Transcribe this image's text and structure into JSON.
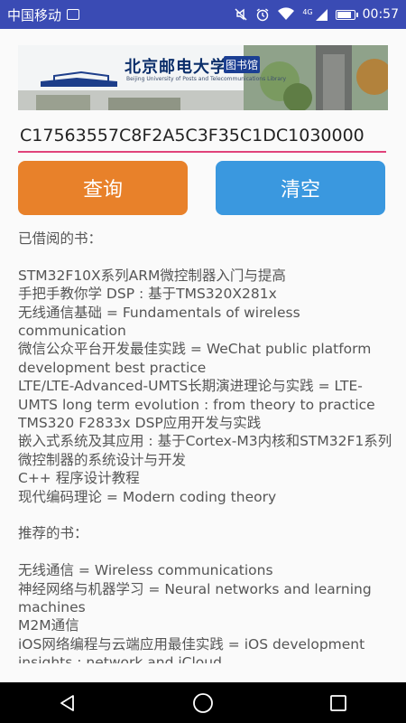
{
  "status_bar": {
    "carrier": "中国移动",
    "network": "4G",
    "time": "00:57",
    "icons": [
      "sim-icon",
      "mute-icon",
      "alarm-icon",
      "wifi-icon",
      "signal-icon",
      "battery-icon"
    ]
  },
  "banner": {
    "title": "北京邮电大学",
    "badge": "图书馆",
    "subtitle": "Beijing University of Posts and Telecommunications Library"
  },
  "search": {
    "value": "C17563557C8F2A5C3F35C1DC1030000"
  },
  "buttons": {
    "query_label": "查询",
    "clear_label": "清空"
  },
  "borrowed": {
    "heading": "已借阅的书：",
    "items": [
      "STM32F10X系列ARM微控制器入门与提高",
      "手把手教你学 DSP : 基于TMS320X281x",
      "无线通信基础 = Fundamentals of wireless communication",
      "微信公众平台开发最佳实践 = WeChat public platform development best practice",
      "LTE/LTE-Advanced-UMTS长期演进理论与实践 = LTE-UMTS long term evolution : from theory to practice",
      "TMS320 F2833x DSP应用开发与实践",
      "嵌入式系统及其应用 : 基于Cortex-M3内核和STM32F1系列微控制器的系统设计与开发",
      "C++ 程序设计教程",
      "现代编码理论 = Modern coding theory"
    ]
  },
  "recommended": {
    "heading": "推荐的书：",
    "items": [
      "无线通信 = Wireless communications",
      "神经网络与机器学习 = Neural networks and learning machines",
      "M2M通信",
      "iOS网络编程与云端应用最佳实践 = iOS development insights : network and iCloud"
    ]
  },
  "nav": {
    "icons": [
      "back-icon",
      "home-icon",
      "recents-icon"
    ]
  },
  "colors": {
    "status_bar": "#3a4bb4",
    "query_button": "#e8812a",
    "clear_button": "#3a98df",
    "input_underline": "#e0427a"
  }
}
